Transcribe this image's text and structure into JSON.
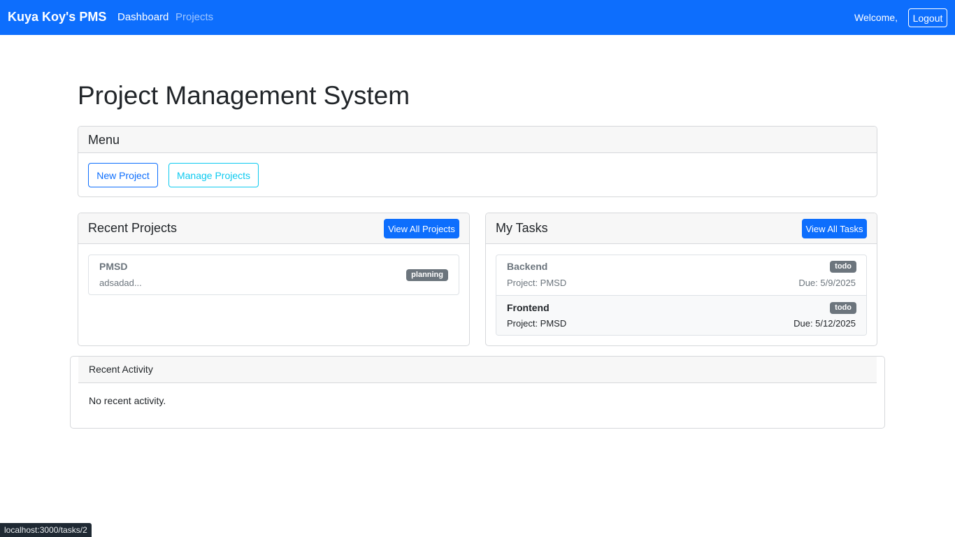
{
  "navbar": {
    "brand": "Kuya Koy's PMS",
    "links": [
      "Dashboard",
      "Projects"
    ],
    "welcome": "Welcome,",
    "logout_label": "Logout"
  },
  "page": {
    "title": "Project Management System"
  },
  "menu": {
    "title": "Menu",
    "new_project_label": "New Project",
    "manage_projects_label": "Manage Projects"
  },
  "recent_projects": {
    "title": "Recent Projects",
    "view_all_label": "View All Projects",
    "items": [
      {
        "name": "PMSD",
        "description": "adsadad...",
        "status": "planning"
      }
    ]
  },
  "my_tasks": {
    "title": "My Tasks",
    "view_all_label": "View All Tasks",
    "items": [
      {
        "title": "Backend",
        "project": "Project: PMSD",
        "due": "Due: 5/9/2025",
        "status": "todo"
      },
      {
        "title": "Frontend",
        "project": "Project: PMSD",
        "due": "Due: 5/12/2025",
        "status": "todo"
      }
    ]
  },
  "recent_activity": {
    "title": "Recent Activity",
    "empty_text": "No recent activity."
  },
  "status_bar": {
    "url": "localhost:3000/tasks/2"
  },
  "colors": {
    "primary": "#0d6efd",
    "info": "#0dcaf0",
    "secondary_badge": "#6c757d"
  }
}
